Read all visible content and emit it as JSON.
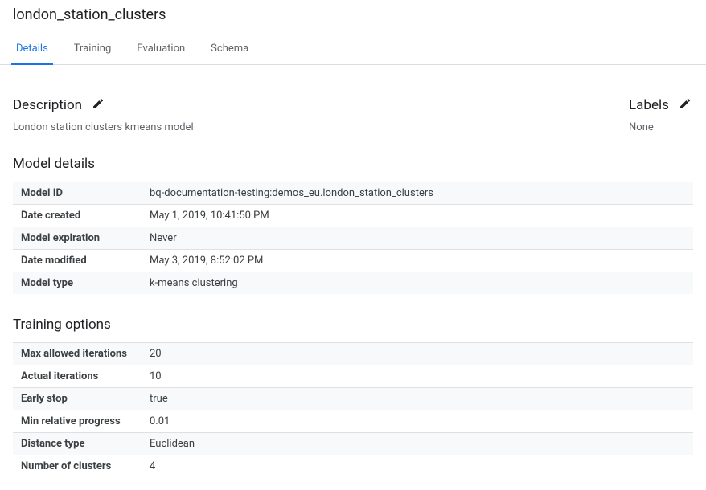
{
  "title": "london_station_clusters",
  "tabs": [
    {
      "label": "Details",
      "active": true
    },
    {
      "label": "Training",
      "active": false
    },
    {
      "label": "Evaluation",
      "active": false
    },
    {
      "label": "Schema",
      "active": false
    }
  ],
  "description": {
    "heading": "Description",
    "text": "London station clusters kmeans model"
  },
  "labels": {
    "heading": "Labels",
    "value": "None"
  },
  "model_details": {
    "heading": "Model details",
    "rows": [
      {
        "key": "Model ID",
        "value": "bq-documentation-testing:demos_eu.london_station_clusters"
      },
      {
        "key": "Date created",
        "value": "May 1, 2019, 10:41:50 PM"
      },
      {
        "key": "Model expiration",
        "value": "Never"
      },
      {
        "key": "Date modified",
        "value": "May 3, 2019, 8:52:02 PM"
      },
      {
        "key": "Model type",
        "value": "k-means clustering"
      }
    ]
  },
  "training_options": {
    "heading": "Training options",
    "rows": [
      {
        "key": "Max allowed iterations",
        "value": "20"
      },
      {
        "key": "Actual iterations",
        "value": "10"
      },
      {
        "key": "Early stop",
        "value": "true"
      },
      {
        "key": "Min relative progress",
        "value": "0.01"
      },
      {
        "key": "Distance type",
        "value": "Euclidean"
      },
      {
        "key": "Number of clusters",
        "value": "4"
      }
    ]
  }
}
